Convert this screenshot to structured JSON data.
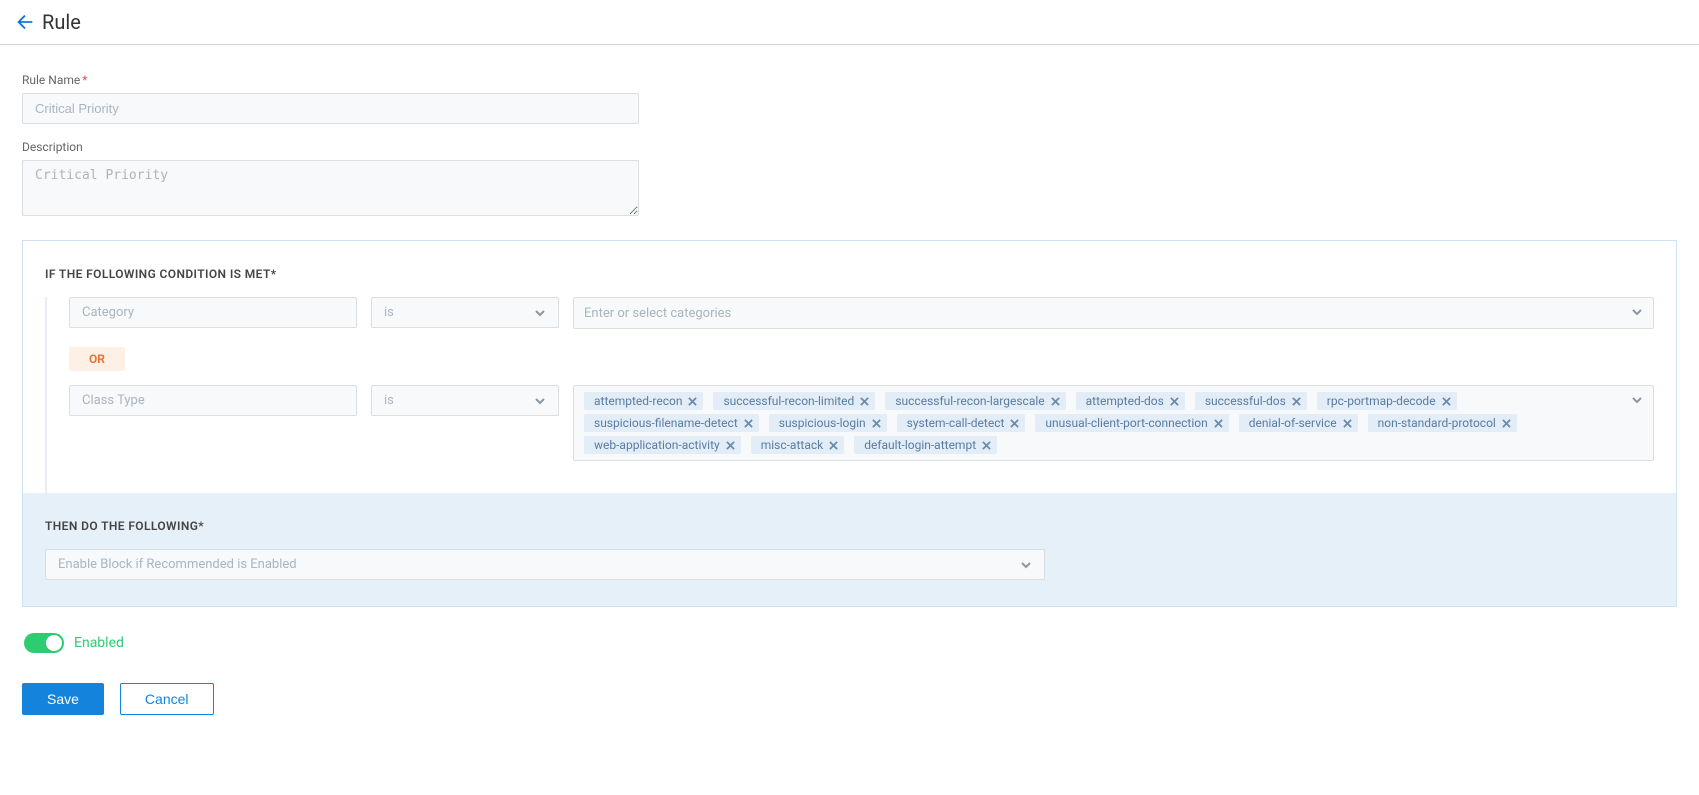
{
  "header": {
    "title": "Rule"
  },
  "form": {
    "name_label": "Rule Name",
    "name_value": "Critical Priority",
    "desc_label": "Description",
    "desc_value": "Critical Priority"
  },
  "condition": {
    "heading": "IF THE FOLLOWING CONDITION IS MET*",
    "or_label": "OR",
    "rows": [
      {
        "field": "Category",
        "op": "is",
        "value_placeholder": "Enter or select categories",
        "tags": []
      },
      {
        "field": "Class Type",
        "op": "is",
        "value_placeholder": "",
        "tags": [
          "attempted-recon",
          "successful-recon-limited",
          "successful-recon-largescale",
          "attempted-dos",
          "successful-dos",
          "rpc-portmap-decode",
          "suspicious-filename-detect",
          "suspicious-login",
          "system-call-detect",
          "unusual-client-port-connection",
          "denial-of-service",
          "non-standard-protocol",
          "web-application-activity",
          "misc-attack",
          "default-login-attempt"
        ]
      }
    ]
  },
  "action": {
    "heading": "THEN DO THE FOLLOWING*",
    "selected": "Enable Block if Recommended is Enabled"
  },
  "toggle": {
    "label": "Enabled",
    "state": true
  },
  "buttons": {
    "save": "Save",
    "cancel": "Cancel"
  }
}
